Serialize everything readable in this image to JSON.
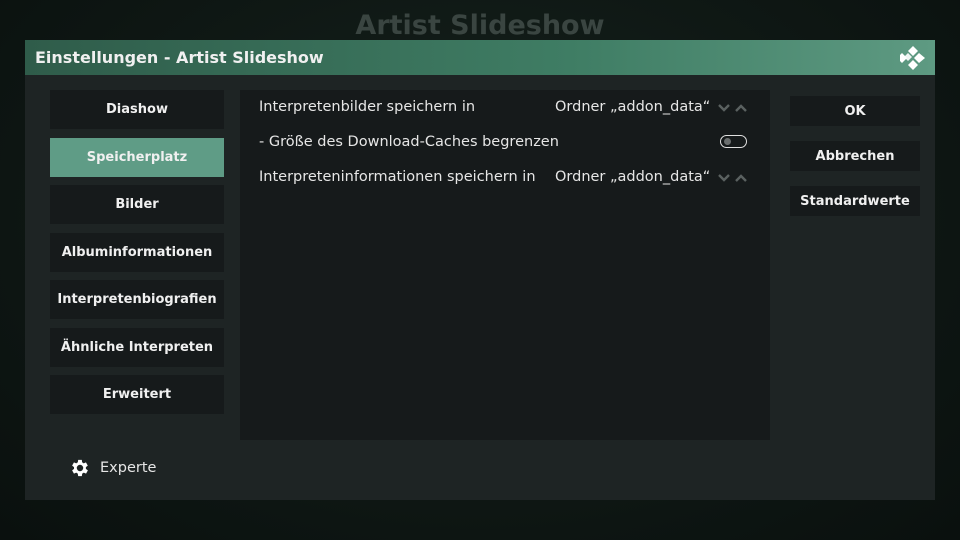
{
  "background": {
    "title": "Artist Slideshow"
  },
  "dialog": {
    "title": "Einstellungen - Artist Slideshow",
    "logo_icon": "kodi-logo-icon"
  },
  "categories": [
    {
      "label": "Diashow",
      "selected": false
    },
    {
      "label": "Speicherplatz",
      "selected": true
    },
    {
      "label": "Bilder",
      "selected": false
    },
    {
      "label": "Albuminformationen",
      "selected": false
    },
    {
      "label": "Interpretenbiografien",
      "selected": false
    },
    {
      "label": "Ähnliche Interpreten",
      "selected": false
    },
    {
      "label": "Erweitert",
      "selected": false
    }
  ],
  "settings": [
    {
      "label": "Interpretenbilder speichern in",
      "value": "Ordner „addon_data“",
      "control": "spinner"
    },
    {
      "label": "- Größe des Download-Caches begrenzen",
      "value": "",
      "control": "toggle",
      "enabled": false
    },
    {
      "label": "Interpreteninformationen speichern in",
      "value": "Ordner „addon_data“",
      "control": "spinner"
    }
  ],
  "buttons": {
    "ok": "OK",
    "cancel": "Abbrechen",
    "defaults": "Standardwerte"
  },
  "level": {
    "icon": "gear-icon",
    "label": "Experte"
  },
  "colors": {
    "accent": "#5f9c86",
    "header_left": "#2f5c4a",
    "header_right": "#5e9a82",
    "panel": "#1e2424",
    "tile": "#161a1b"
  }
}
